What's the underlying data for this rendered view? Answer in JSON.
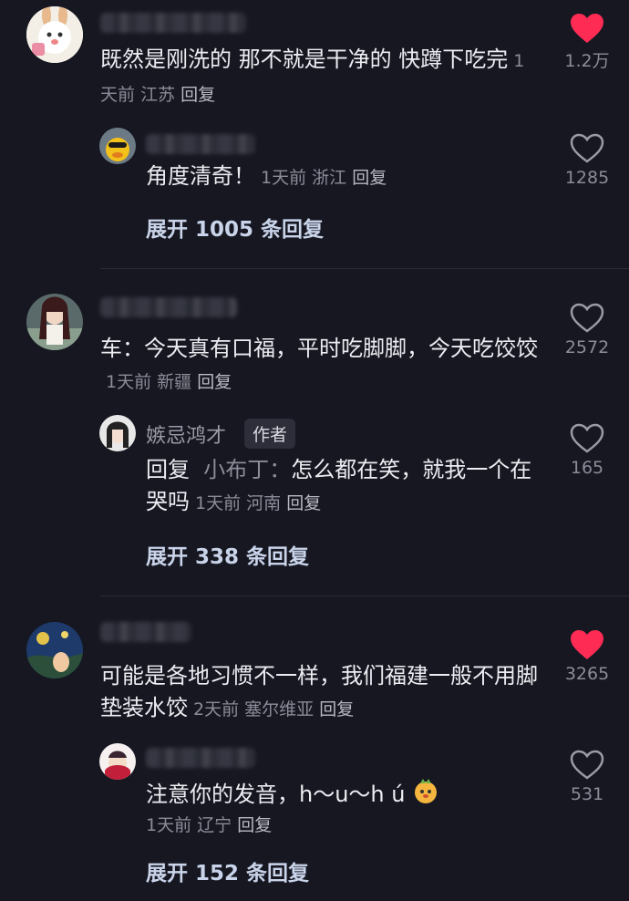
{
  "threads": [
    {
      "comment": {
        "text": "既然是刚洗的 那不就是干净的 快蹲下吃完",
        "time": "1天前",
        "location": "江苏",
        "reply": "回复",
        "likes": "1.2万",
        "liked": true
      },
      "reply": {
        "text": "角度清奇！",
        "time": "1天前",
        "location": "浙江",
        "reply": "回复",
        "likes": "1285",
        "liked": false
      },
      "expand": "展开 1005 条回复"
    },
    {
      "comment": {
        "text": "车：今天真有口福，平时吃脚脚，今天吃饺饺",
        "time": "1天前",
        "location": "新疆",
        "reply": "回复",
        "likes": "2572",
        "liked": false
      },
      "reply": {
        "author": "嫉忌鸿才",
        "author_tag": "作者",
        "reply_prefix": "回复",
        "reply_to": "小布丁：",
        "text": "怎么都在笑，就我一个在哭吗",
        "time": "1天前",
        "location": "河南",
        "reply": "回复",
        "likes": "165",
        "liked": false
      },
      "expand": "展开 338 条回复"
    },
    {
      "comment": {
        "text": "可能是各地习惯不一样，我们福建一般不用脚垫装水饺",
        "time": "2天前",
        "location": "塞尔维亚",
        "reply": "回复",
        "likes": "3265",
        "liked": true
      },
      "reply": {
        "text": "注意你的发音，h～u～h ú",
        "time": "1天前",
        "location": "辽宁",
        "reply": "回复",
        "likes": "531",
        "liked": false
      },
      "expand": "展开 152 条回复"
    }
  ],
  "colors": {
    "background": "#161721",
    "like_active": "#fe2c55",
    "like_inactive": "#9a9ba6",
    "expand_text": "#c9d4ea"
  },
  "icons": [
    "heart-filled-icon",
    "heart-outline-icon",
    "emoji-sticker-icon"
  ]
}
